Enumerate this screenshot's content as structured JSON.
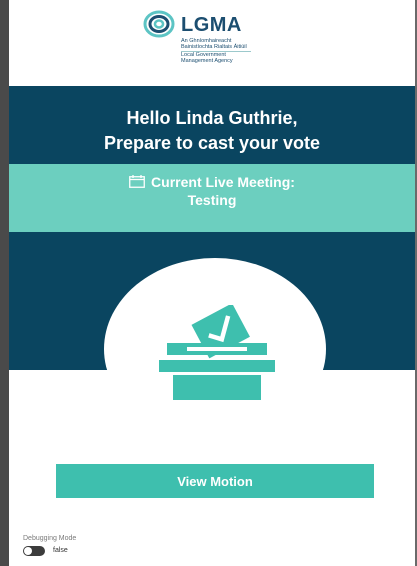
{
  "logo": {
    "brand": "LGMA",
    "irish_line1": "An Ghníomhaireacht",
    "irish_line2": "Bainistíochta Rialtais Áitiúil",
    "english_line1": "Local Government",
    "english_line2": "Management Agency",
    "icon": "lgma-swirl-icon"
  },
  "hero": {
    "greeting_line1": "Hello Linda Guthrie,",
    "greeting_line2": "Prepare to cast your vote",
    "meeting_label": "Current Live Meeting:",
    "meeting_name": "Testing",
    "meeting_icon": "calendar-icon",
    "illustration_icon": "ballot-box-icon"
  },
  "actions": {
    "view_motion_label": "View Motion"
  },
  "debug": {
    "label": "Debugging Mode",
    "value": "false"
  },
  "colors": {
    "dark_band": "#0a4560",
    "teal_band": "#6ccfbf",
    "button": "#3ebfae",
    "icon": "#3ebfae",
    "brand": "#1c4e70"
  }
}
